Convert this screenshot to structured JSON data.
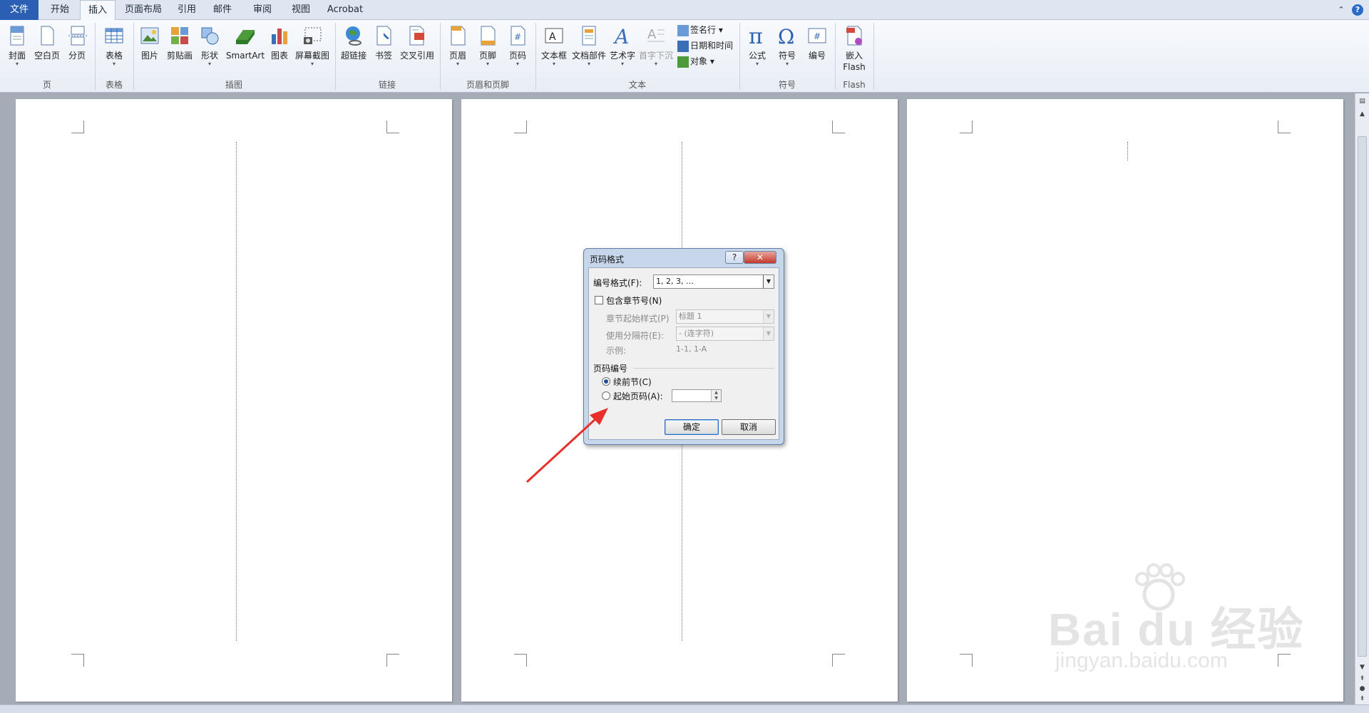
{
  "tabs": [
    {
      "label": "文件"
    },
    {
      "label": "开始"
    },
    {
      "label": "插入"
    },
    {
      "label": "页面布局"
    },
    {
      "label": "引用"
    },
    {
      "label": "邮件"
    },
    {
      "label": "审阅"
    },
    {
      "label": "视图"
    },
    {
      "label": "Acrobat"
    }
  ],
  "ribbon": {
    "groups": {
      "pages": "页",
      "tables": "表格",
      "illustrations": "插图",
      "links": "链接",
      "header_footer": "页眉和页脚",
      "text": "文本",
      "symbols": "符号",
      "flash": "Flash"
    },
    "buttons": {
      "cover": "封面",
      "blank_page": "空白页",
      "page_break": "分页",
      "table": "表格",
      "picture": "图片",
      "clipart": "剪贴画",
      "shapes": "形状",
      "smartart": "SmartArt",
      "chart": "图表",
      "screenshot": "屏幕截图",
      "hyperlink": "超链接",
      "bookmark": "书签",
      "cross_ref": "交叉引用",
      "header": "页眉",
      "footer": "页脚",
      "page_number": "页码",
      "textbox": "文本框",
      "quick_parts": "文档部件",
      "wordart": "艺术字",
      "dropcap": "首字下沉",
      "signature_line": "签名行",
      "date_time": "日期和时间",
      "object": "对象",
      "equation": "公式",
      "symbol": "符号",
      "numbering": "编号",
      "embed_flash_1": "嵌入",
      "embed_flash_2": "Flash"
    }
  },
  "dialog": {
    "title": "页码格式",
    "help_label": "?",
    "close_label": "✕",
    "number_format_label": "编号格式(F):",
    "number_format_value": "1, 2, 3, …",
    "include_chapter_label": "包含章节号(N)",
    "chapter_style_label": "章节起始样式(P)",
    "chapter_style_value": "标题 1",
    "separator_label": "使用分隔符(E):",
    "separator_value": "-   (连字符)",
    "example_label": "示例:",
    "example_value": "1-1, 1-A",
    "page_numbering_label": "页码编号",
    "continue_label": "续前节(C)",
    "start_at_label": "起始页码(A):",
    "start_at_value": "",
    "ok_label": "确定",
    "cancel_label": "取消"
  },
  "watermark": {
    "brand": "Bai du 经验",
    "url": "jingyan.baidu.com"
  },
  "colors": {
    "file_tab": "#2b5fb3",
    "annotation_arrow": "#e8302a",
    "doc_background": "#a6acb6"
  }
}
